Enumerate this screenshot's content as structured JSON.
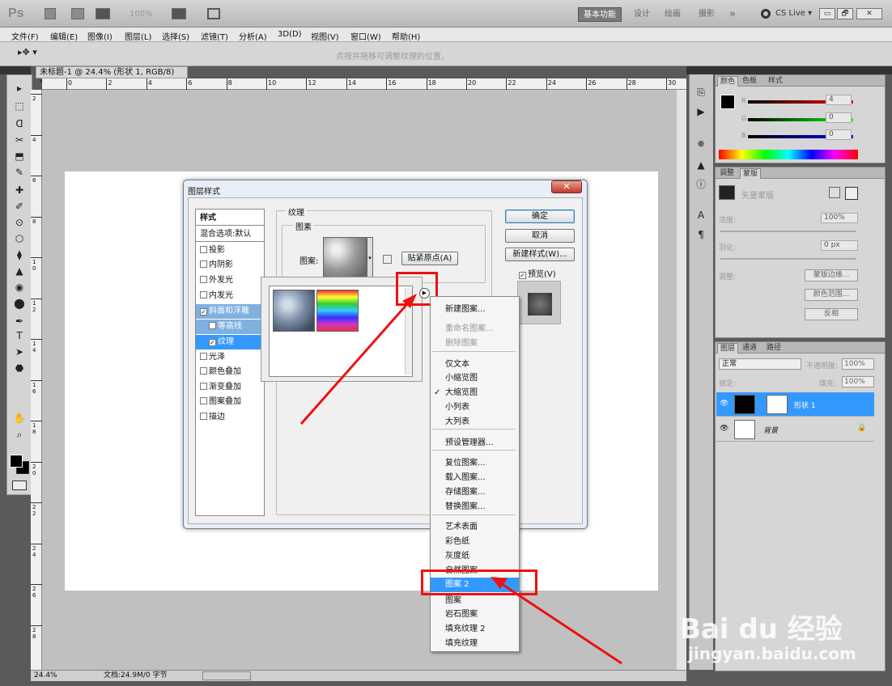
{
  "app": {
    "logo": "Ps",
    "zoom": "100%",
    "workspaces": [
      "基本功能",
      "设计",
      "绘画",
      "摄影"
    ],
    "more": "»",
    "cslive": "CS Live ▾",
    "win_min": "▭",
    "win_max": "🗗",
    "win_close": "✕"
  },
  "menus": [
    "文件(F)",
    "编辑(E)",
    "图像(I)",
    "图层(L)",
    "选择(S)",
    "滤镜(T)",
    "分析(A)",
    "3D(D)",
    "视图(V)",
    "窗口(W)",
    "帮助(H)"
  ],
  "options": {
    "hint": "点按并拖移可调整纹理的位置。"
  },
  "document": {
    "tab": "未标题-1 @ 24.4% (形状 1, RGB/8) *",
    "tab_close": "✕",
    "zoom": "24.4%",
    "info": "文档:24.9M/0 字节"
  },
  "ruler": {
    "h": [
      "0",
      "2",
      "4",
      "6",
      "8",
      "10",
      "12",
      "14",
      "16",
      "18",
      "20",
      "22",
      "24",
      "26",
      "28",
      "30"
    ],
    "v": [
      "2",
      "4",
      "6",
      "8",
      "1 0",
      "1 2",
      "1 4",
      "1 6",
      "1 8",
      "2 0",
      "2 2",
      "2 4",
      "2 6",
      "2 8"
    ]
  },
  "tools": [
    "▸",
    "⬚",
    "ᗡ",
    "✂",
    "⬒",
    "✎",
    "✚",
    "✐",
    "⊙",
    "⬡",
    "⧫",
    "▲",
    "◉",
    "⬤",
    "✒",
    "T",
    "➤",
    "⬣",
    "✋",
    "⌕"
  ],
  "dialog": {
    "title": "图层样式",
    "close": "✕",
    "styles_header": "样式",
    "blend": "混合选项:默认",
    "items": [
      {
        "label": "投影",
        "checked": ""
      },
      {
        "label": "内阴影",
        "checked": ""
      },
      {
        "label": "外发光",
        "checked": ""
      },
      {
        "label": "内发光",
        "checked": ""
      },
      {
        "label": "斜面和浮雕",
        "checked": "✓"
      },
      {
        "label": "等高线",
        "checked": ""
      },
      {
        "label": "纹理",
        "checked": "✓"
      },
      {
        "label": "光泽",
        "checked": ""
      },
      {
        "label": "颜色叠加",
        "checked": ""
      },
      {
        "label": "渐变叠加",
        "checked": ""
      },
      {
        "label": "图案叠加",
        "checked": ""
      },
      {
        "label": "描边",
        "checked": ""
      }
    ],
    "group_title": "纹理",
    "sub_title": "图素",
    "pattern_label": "图案:",
    "snap": "贴紧原点(A)",
    "ok": "确定",
    "cancel": "取消",
    "new_style": "新建样式(W)...",
    "preview": "预览(V)",
    "preview_check": "✓"
  },
  "popup": {
    "items": [
      {
        "label": "新建图案...",
        "state": "normal",
        "check": ""
      },
      {
        "label": "重命名图案...",
        "state": "disabled",
        "check": ""
      },
      {
        "label": "删除图案",
        "state": "disabled",
        "check": ""
      },
      {
        "label": "仅文本",
        "state": "normal",
        "check": ""
      },
      {
        "label": "小缩览图",
        "state": "normal",
        "check": ""
      },
      {
        "label": "大缩览图",
        "state": "normal",
        "check": "✓"
      },
      {
        "label": "小列表",
        "state": "normal",
        "check": ""
      },
      {
        "label": "大列表",
        "state": "normal",
        "check": ""
      },
      {
        "label": "预设管理器...",
        "state": "normal",
        "check": ""
      },
      {
        "label": "复位图案...",
        "state": "normal",
        "check": ""
      },
      {
        "label": "载入图案...",
        "state": "normal",
        "check": ""
      },
      {
        "label": "存储图案...",
        "state": "normal",
        "check": ""
      },
      {
        "label": "替换图案...",
        "state": "normal",
        "check": ""
      },
      {
        "label": "艺术表面",
        "state": "normal",
        "check": ""
      },
      {
        "label": "彩色纸",
        "state": "normal",
        "check": ""
      },
      {
        "label": "灰度纸",
        "state": "normal",
        "check": ""
      },
      {
        "label": "自然图案",
        "state": "normal",
        "check": ""
      },
      {
        "label": "图案 2",
        "state": "highlight",
        "check": ""
      },
      {
        "label": "图案",
        "state": "normal",
        "check": ""
      },
      {
        "label": "岩石图案",
        "state": "normal",
        "check": ""
      },
      {
        "label": "填充纹理 2",
        "state": "normal",
        "check": ""
      },
      {
        "label": "填充纹理",
        "state": "normal",
        "check": ""
      }
    ]
  },
  "color_panel": {
    "tabs": [
      "颜色",
      "色板",
      "样式"
    ],
    "r_label": "R",
    "g_label": "G",
    "b_label": "B",
    "r": "4",
    "g": "0",
    "b": "0"
  },
  "adjust_panel": {
    "tabs": [
      "调整",
      "蒙版"
    ],
    "mask_title": "矢量蒙版",
    "density_label": "浓度:",
    "density": "100%",
    "feather_label": "羽化:",
    "feather": "0 px",
    "adjust_label": "调整:",
    "btn_edge": "蒙版边缘...",
    "btn_range": "颜色范围...",
    "btn_invert": "反相"
  },
  "layers_panel": {
    "tabs": [
      "图层",
      "通道",
      "路径"
    ],
    "blend": "正常",
    "opacity_label": "不透明度:",
    "opacity": "100%",
    "lock_label": "锁定:",
    "fill_label": "填充:",
    "fill": "100%",
    "layers": [
      {
        "name": "形状 1",
        "selected": true
      },
      {
        "name": "背景",
        "selected": false
      }
    ]
  },
  "watermark": {
    "brand": "Bai du 经验",
    "url": "jingyan.baidu.com"
  },
  "colors": {
    "accent": "#3399ff",
    "annotation": "#ee1111"
  }
}
